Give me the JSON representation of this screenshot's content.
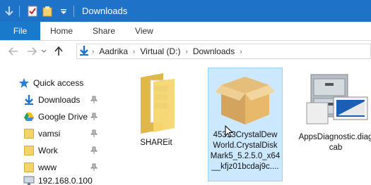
{
  "titlebar": {
    "title": "Downloads",
    "qa_icons": [
      "down-arrow-icon",
      "properties-checkmark-icon",
      "new-folder-icon",
      "customize-dropdown-icon"
    ]
  },
  "ribbon": {
    "tabs": [
      "File",
      "Home",
      "Share",
      "View"
    ]
  },
  "address": {
    "breadcrumbs": [
      "Aadrika",
      "Virtual (D:)",
      "Downloads"
    ]
  },
  "nav": {
    "items": [
      {
        "label": "Quick access",
        "icon": "star-icon"
      },
      {
        "label": "Downloads",
        "icon": "download-arrow-icon",
        "pinned": true
      },
      {
        "label": "Google Drive",
        "icon": "google-drive-icon",
        "pinned": true
      },
      {
        "label": "vamsi",
        "icon": "folder-icon",
        "pinned": true
      },
      {
        "label": "Work",
        "icon": "folder-icon",
        "pinned": true
      },
      {
        "label": "www",
        "icon": "folder-icon",
        "pinned": true
      },
      {
        "label": "192.168.0.100",
        "icon": "network-icon"
      }
    ]
  },
  "files": [
    {
      "name": "SHAREit",
      "icon": "folder-icon",
      "selected": false
    },
    {
      "name": "45313CrystalDewWorld.CrystalDiskMark5_5.2.5.0_x64__kfjz01bcdaj9c....",
      "icon": "package-box-icon",
      "selected": true
    },
    {
      "name": "AppsDiagnostic.diagcab",
      "icon": "file-cabinet-icon",
      "selected": false
    }
  ],
  "colors": {
    "titlebar": "#1e73c8",
    "file_tab": "#1979ca",
    "selection": "#cce8ff",
    "folder": "#f4d36b"
  }
}
